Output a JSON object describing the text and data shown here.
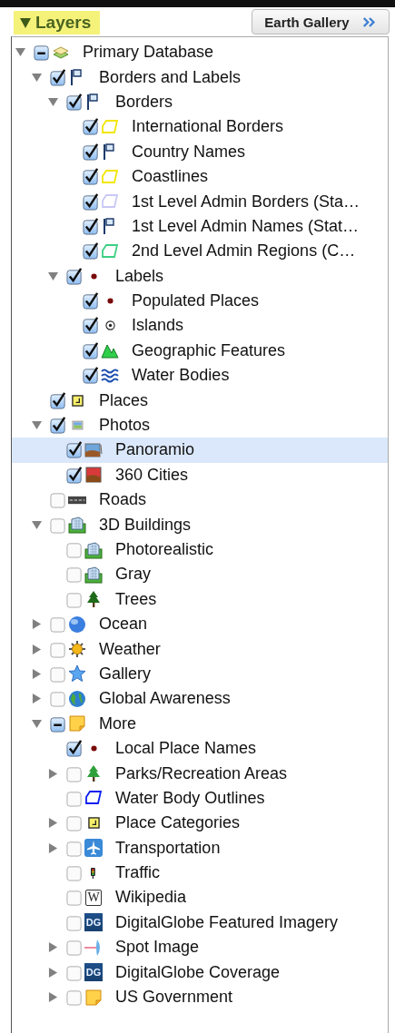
{
  "header": {
    "title": "Layers",
    "expanded": true,
    "gallery_button": "Earth Gallery"
  },
  "layers": [
    {
      "label": "Primary Database",
      "kind": "database",
      "checked": true,
      "partial": true,
      "expanded": true,
      "selected": false,
      "children": [
        {
          "label": "Borders and Labels",
          "kind": "flag",
          "checked": true,
          "partial": false,
          "expanded": true,
          "selected": false,
          "children": [
            {
              "label": "Borders",
              "kind": "flag",
              "checked": true,
              "partial": false,
              "expanded": true,
              "selected": false,
              "children": [
                {
                  "label": "International Borders",
                  "kind": "polygon",
                  "color": "#f2e600",
                  "checked": true,
                  "partial": false,
                  "selected": false
                },
                {
                  "label": "Country Names",
                  "kind": "flag",
                  "checked": true,
                  "partial": false,
                  "selected": false
                },
                {
                  "label": "Coastlines",
                  "kind": "polygon",
                  "color": "#f2e600",
                  "checked": true,
                  "partial": false,
                  "selected": false
                },
                {
                  "label": "1st Level Admin Borders (Sta…",
                  "kind": "polygon",
                  "color": "#c8c8f4",
                  "checked": true,
                  "partial": false,
                  "selected": false
                },
                {
                  "label": "1st Level Admin Names (Stat…",
                  "kind": "flag",
                  "checked": true,
                  "partial": false,
                  "selected": false
                },
                {
                  "label": "2nd Level Admin Regions (C…",
                  "kind": "polygon",
                  "color": "#3ccf82",
                  "checked": true,
                  "partial": false,
                  "selected": false
                }
              ]
            },
            {
              "label": "Labels",
              "kind": "dot",
              "checked": true,
              "partial": false,
              "expanded": true,
              "selected": false,
              "children": [
                {
                  "label": "Populated Places",
                  "kind": "dot",
                  "checked": true,
                  "partial": false,
                  "selected": false
                },
                {
                  "label": "Islands",
                  "kind": "target",
                  "checked": true,
                  "partial": false,
                  "selected": false
                },
                {
                  "label": "Geographic Features",
                  "kind": "mountain",
                  "checked": true,
                  "partial": false,
                  "selected": false
                },
                {
                  "label": "Water Bodies",
                  "kind": "waves",
                  "checked": true,
                  "partial": false,
                  "selected": false
                }
              ]
            }
          ]
        },
        {
          "label": "Places",
          "kind": "place",
          "checked": true,
          "partial": false,
          "selected": false
        },
        {
          "label": "Photos",
          "kind": "photo-small",
          "checked": true,
          "partial": false,
          "expanded": true,
          "selected": false,
          "children": [
            {
              "label": "Panoramio",
              "kind": "photo",
              "checked": true,
              "partial": false,
              "selected": true
            },
            {
              "label": "360 Cities",
              "kind": "photo-red",
              "checked": true,
              "partial": false,
              "selected": false
            }
          ]
        },
        {
          "label": "Roads",
          "kind": "road",
          "checked": false,
          "partial": false,
          "selected": false
        },
        {
          "label": "3D Buildings",
          "kind": "building",
          "checked": false,
          "partial": false,
          "expanded": true,
          "selected": false,
          "children": [
            {
              "label": "Photorealistic",
              "kind": "building",
              "checked": false,
              "partial": false,
              "selected": false
            },
            {
              "label": "Gray",
              "kind": "building",
              "checked": false,
              "partial": false,
              "selected": false
            },
            {
              "label": "Trees",
              "kind": "tree",
              "checked": false,
              "partial": false,
              "selected": false
            }
          ]
        },
        {
          "label": "Ocean",
          "kind": "ocean",
          "checked": false,
          "partial": false,
          "expanded": false,
          "selected": false
        },
        {
          "label": "Weather",
          "kind": "sun",
          "checked": false,
          "partial": false,
          "expanded": false,
          "selected": false
        },
        {
          "label": "Gallery",
          "kind": "star",
          "checked": false,
          "partial": false,
          "expanded": false,
          "selected": false
        },
        {
          "label": "Global Awareness",
          "kind": "earth",
          "checked": false,
          "partial": false,
          "expanded": false,
          "selected": false
        },
        {
          "label": "More",
          "kind": "note",
          "checked": true,
          "partial": true,
          "expanded": true,
          "selected": false,
          "children": [
            {
              "label": "Local Place Names",
              "kind": "dot",
              "checked": true,
              "partial": false,
              "selected": false
            },
            {
              "label": "Parks/Recreation Areas",
              "kind": "tree-green",
              "checked": false,
              "partial": false,
              "expanded": false,
              "selected": false
            },
            {
              "label": "Water Body Outlines",
              "kind": "polygon",
              "color": "#0a1ef0",
              "checked": false,
              "partial": false,
              "selected": false
            },
            {
              "label": "Place Categories",
              "kind": "place",
              "checked": false,
              "partial": false,
              "expanded": false,
              "selected": false
            },
            {
              "label": "Transportation",
              "kind": "airplane",
              "checked": false,
              "partial": false,
              "expanded": false,
              "selected": false
            },
            {
              "label": "Traffic",
              "kind": "traffic",
              "checked": false,
              "partial": false,
              "selected": false
            },
            {
              "label": "Wikipedia",
              "kind": "badge",
              "badge": "W",
              "checked": false,
              "partial": false,
              "selected": false
            },
            {
              "label": "DigitalGlobe Featured Imagery",
              "kind": "badge-blue",
              "badge": "DG",
              "checked": false,
              "partial": false,
              "selected": false
            },
            {
              "label": "Spot Image",
              "kind": "spot",
              "checked": false,
              "partial": false,
              "expanded": false,
              "selected": false
            },
            {
              "label": "DigitalGlobe Coverage",
              "kind": "badge-blue",
              "badge": "DG",
              "checked": false,
              "partial": false,
              "expanded": false,
              "selected": false
            },
            {
              "label": "US Government",
              "kind": "note",
              "checked": false,
              "partial": false,
              "expanded": false,
              "selected": false
            }
          ]
        }
      ]
    }
  ]
}
